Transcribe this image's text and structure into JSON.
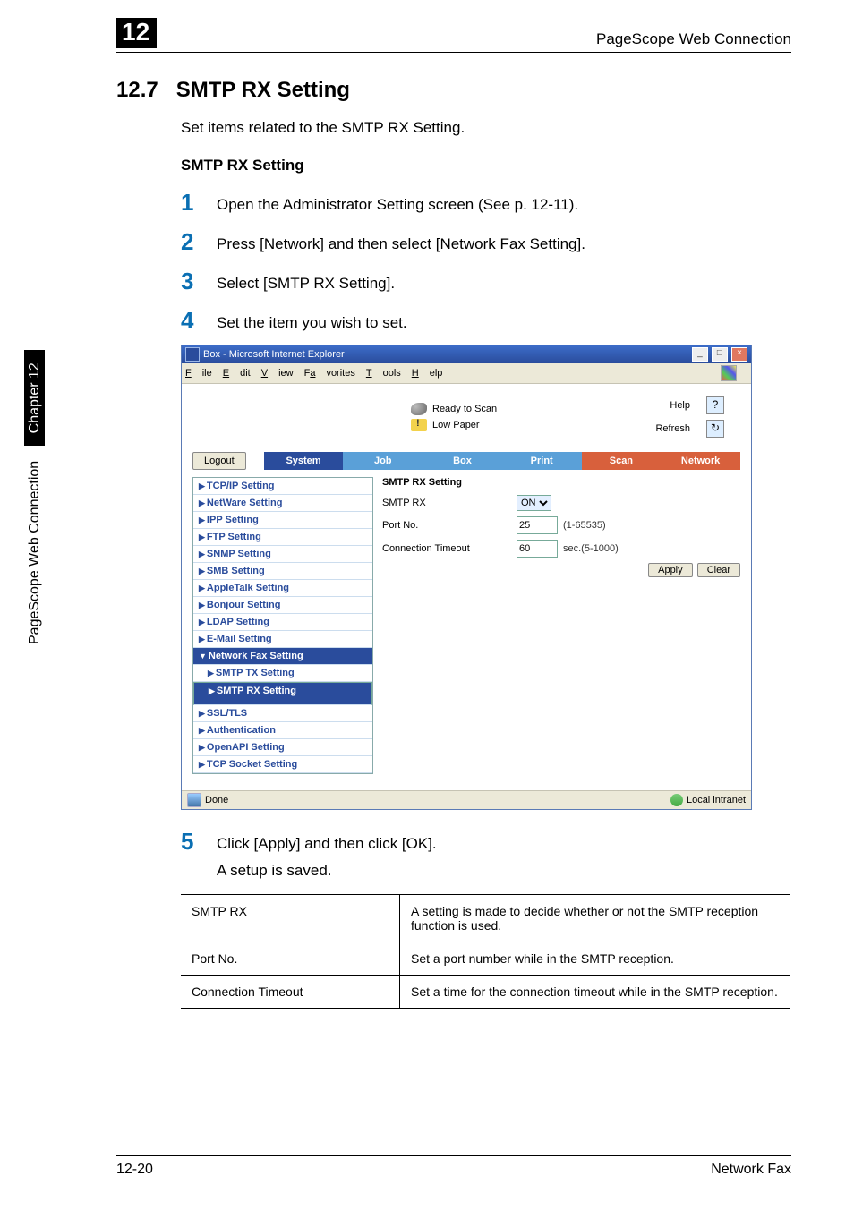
{
  "header": {
    "chapter_badge": "12",
    "right_text": "PageScope Web Connection"
  },
  "section": {
    "number": "12.7",
    "title": "SMTP RX Setting",
    "intro": "Set items related to the SMTP RX Setting.",
    "sub": "SMTP RX Setting"
  },
  "steps": {
    "s1": "Open the Administrator Setting screen (See p. 12-11).",
    "s2": "Press [Network] and then select [Network Fax Setting].",
    "s3": "Select [SMTP RX Setting].",
    "s4": "Set the item you wish to set.",
    "s5": "Click [Apply] and then click [OK].",
    "s5_after": "A setup is saved."
  },
  "ie": {
    "title": "Box - Microsoft Internet Explorer",
    "menu": {
      "file": "File",
      "edit": "Edit",
      "view": "View",
      "favorites": "Favorites",
      "tools": "Tools",
      "help": "Help"
    },
    "status": {
      "ready": "Ready to Scan",
      "low": "Low Paper"
    },
    "links": {
      "help": "Help",
      "refresh": "Refresh"
    },
    "logout": "Logout",
    "tabs": {
      "system": "System",
      "job": "Job",
      "box": "Box",
      "print": "Print",
      "scan": "Scan",
      "network": "Network"
    },
    "sidebar": {
      "tcp": "TCP/IP Setting",
      "netware": "NetWare Setting",
      "ipp": "IPP Setting",
      "ftp": "FTP Setting",
      "snmp": "SNMP Setting",
      "smb": "SMB Setting",
      "apple": "AppleTalk Setting",
      "bonjour": "Bonjour Setting",
      "ldap": "LDAP Setting",
      "email": "E-Mail Setting",
      "netfax": "Network Fax Setting",
      "smtptx": "SMTP TX Setting",
      "smtprx": "SMTP RX Setting",
      "ssl": "SSL/TLS",
      "auth": "Authentication",
      "openapi": "OpenAPI Setting",
      "tcpsock": "TCP Socket Setting"
    },
    "form": {
      "title": "SMTP RX Setting",
      "r1": {
        "label": "SMTP RX",
        "value": "ON"
      },
      "r2": {
        "label": "Port No.",
        "value": "25",
        "unit": "(1-65535)"
      },
      "r3": {
        "label": "Connection Timeout",
        "value": "60",
        "unit": "sec.(5-1000)"
      },
      "apply": "Apply",
      "clear": "Clear"
    },
    "statusbar": {
      "done": "Done",
      "zone": "Local intranet"
    }
  },
  "table": {
    "r1": {
      "a": "SMTP RX",
      "b": "A setting is made to decide whether or not the SMTP reception function is used."
    },
    "r2": {
      "a": "Port No.",
      "b": "Set a port number while in the SMTP reception."
    },
    "r3": {
      "a": "Connection Timeout",
      "b": "Set a time for the connection timeout while in the SMTP reception."
    }
  },
  "side": {
    "text": "PageScope Web Connection",
    "chapter": "Chapter 12"
  },
  "footer": {
    "left": "12-20",
    "right": "Network Fax"
  }
}
